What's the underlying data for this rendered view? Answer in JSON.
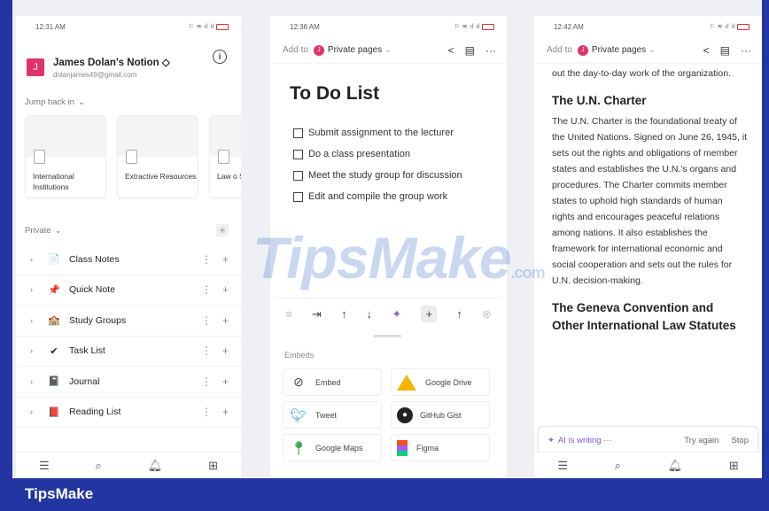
{
  "panel1": {
    "status_time": "12:31 AM",
    "workspace_name": "James Dolan's Notion ◇",
    "workspace_email": "dolanjames49@gmail.com",
    "avatar_letter": "J",
    "jump_label": "Jump back in",
    "recent": [
      {
        "title": "International Institutions"
      },
      {
        "title": "Extractive Resources"
      },
      {
        "title": "Law o Succ"
      }
    ],
    "private_label": "Private",
    "pages": [
      {
        "label": "Class Notes",
        "icon": "📄"
      },
      {
        "label": "Quick Note",
        "icon": "📌"
      },
      {
        "label": "Study Groups",
        "icon": "🏫"
      },
      {
        "label": "Task List",
        "icon": "✔"
      },
      {
        "label": "Journal",
        "icon": "📓"
      },
      {
        "label": "Reading List",
        "icon": "📕"
      }
    ]
  },
  "panel2": {
    "status_time": "12:36 AM",
    "add_to": "Add to",
    "location": "Private pages",
    "avatar_letter": "J",
    "title": "To Do List",
    "todos": [
      "Submit assignment to the lecturer",
      "Do a class presentation",
      "Meet the study group for discussion",
      "Edit and compile the group work"
    ],
    "embeds_label": "Embeds",
    "embeds": [
      {
        "label": "Embed"
      },
      {
        "label": "Google Drive"
      },
      {
        "label": "Tweet"
      },
      {
        "label": "GitHub Gist"
      },
      {
        "label": "Google Maps"
      },
      {
        "label": "Figma"
      }
    ]
  },
  "panel3": {
    "status_time": "12:42 AM",
    "add_to": "Add to",
    "location": "Private pages",
    "avatar_letter": "J",
    "intro_text": "out the day-to-day work of the organization.",
    "heading1": "The U.N. Charter",
    "paragraph1": "The U.N. Charter is the foundational treaty of the United Nations. Signed on June 26, 1945, it sets out the rights and obligations of member states and establishes the U.N.'s organs and procedures. The Charter commits member states to uphold high standards of human rights and encourages peaceful relations among nations. It also establishes the framework for international economic and social cooperation and sets out the rules for U.N. decision-making.",
    "heading2": "The Geneva Convention and Other International Law Statutes",
    "ai_status": "AI is writing ···",
    "try_again": "Try again",
    "stop": "Stop"
  },
  "watermark": {
    "main": "TipsMake",
    "suffix": ".com"
  },
  "brand": "TipsMake",
  "colors": {
    "accent": "#e0336a",
    "brand_bar": "#2335a0",
    "ai_purple": "#7b56d6"
  }
}
